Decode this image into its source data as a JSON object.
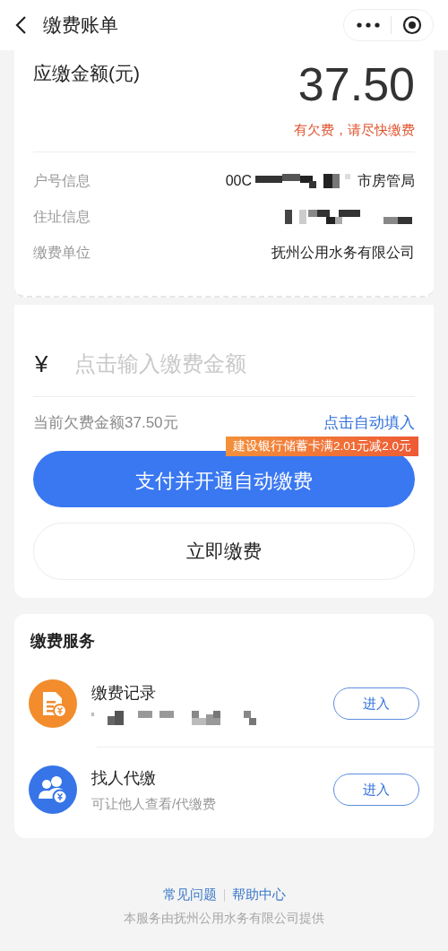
{
  "header": {
    "title": "缴费账单"
  },
  "bill": {
    "amount_label": "应缴金额(元)",
    "amount": "37.50",
    "warning": "有欠费，请尽快缴费",
    "info": [
      {
        "label": "户号信息",
        "prefix": "00C",
        "redacted": true,
        "suffix": "市房管局"
      },
      {
        "label": "住址信息",
        "redacted": true
      },
      {
        "label": "缴费单位",
        "value": "抚州公用水务有限公司",
        "redacted": false
      }
    ]
  },
  "payment": {
    "currency": "¥",
    "placeholder": "点击输入缴费金额",
    "owed": "当前欠费金额37.50元",
    "autofill": "点击自动填入",
    "promo": "建设银行储蓄卡满2.01元减2.0元",
    "primary_button": "支付并开通自动缴费",
    "secondary_button": "立即缴费"
  },
  "services": {
    "title": "缴费服务",
    "items": [
      {
        "kind": "record",
        "name": "缴费记录",
        "redacted": true,
        "button": "进入"
      },
      {
        "kind": "proxy",
        "name": "找人代缴",
        "subtitle": "可让他人查看/代缴费",
        "redacted": false,
        "button": "进入"
      }
    ]
  },
  "footer": {
    "links": [
      "常见问题",
      "帮助中心"
    ],
    "provider": "本服务由抚州公用水务有限公司提供"
  }
}
